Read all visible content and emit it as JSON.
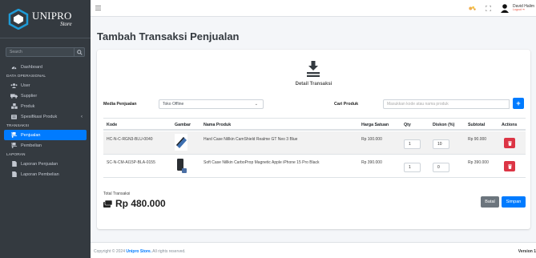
{
  "brand": {
    "name": "UNIPRO",
    "sub": "Store",
    "logo_color": "#1f9bd7"
  },
  "sidebar": {
    "search_placeholder": "Search",
    "items": [
      {
        "type": "item",
        "label": "Dashboard",
        "icon": "dashboard-icon"
      },
      {
        "type": "header",
        "label": "DATA OPERASIONAL"
      },
      {
        "type": "item",
        "label": "User",
        "icon": "users-icon"
      },
      {
        "type": "item",
        "label": "Supplier",
        "icon": "truck-icon"
      },
      {
        "type": "item",
        "label": "Produk",
        "icon": "boxes-icon"
      },
      {
        "type": "item",
        "label": "Spesifikasi Produk",
        "icon": "list-icon",
        "caret": "‹"
      },
      {
        "type": "header",
        "label": "TRANSAKSI"
      },
      {
        "type": "item",
        "label": "Penjualan",
        "icon": "dolly-icon",
        "active": true
      },
      {
        "type": "item",
        "label": "Pembelian",
        "icon": "dolly-icon"
      },
      {
        "type": "header",
        "label": "LAPORAN"
      },
      {
        "type": "item",
        "label": "Laporan Penjualan",
        "icon": "file-icon"
      },
      {
        "type": "item",
        "label": "Laporan Pembelian",
        "icon": "file-icon"
      }
    ]
  },
  "topbar": {
    "user_name": "David Halim",
    "user_role": "Logout ⇥"
  },
  "page": {
    "title": "Tambah Transaksi Penjualan"
  },
  "form": {
    "hero_title": "Detail Transaksi",
    "media_label": "Media Penjualan",
    "media_value": "Toko Offline",
    "search_label": "Cari Produk",
    "search_placeholder": "Masukkan kode atau nama produk",
    "add_symbol": "+"
  },
  "table": {
    "headers": [
      "Kode",
      "Gambar",
      "Nama Produk",
      "Harga Satuan",
      "Qty",
      "Diskon (%)",
      "Subtotal",
      "Actions"
    ],
    "rows": [
      {
        "kode": "HC-N-C-RGN3-BLU-0040",
        "nama": "Hard Case Nillkin CamShield Realme GT Neo 3 Blue",
        "harga": "Rp 100.000",
        "qty": "1",
        "diskon": "10",
        "subtotal": "Rp 90.000"
      },
      {
        "kode": "SC-N-CM-AI15P-BLA-0155",
        "nama": "Soft Case Nillkin CarboProp Magnetic Apple iPhone 15 Pro Black",
        "harga": "Rp 390.000",
        "qty": "1",
        "diskon": "0",
        "subtotal": "Rp 390.000"
      }
    ]
  },
  "summary": {
    "total_label": "Total Transaksi",
    "total_value": "Rp 480.000"
  },
  "buttons": {
    "batal": "Batal",
    "simpan": "Simpan"
  },
  "footer": {
    "copy_prefix": "Copyright © 2024 ",
    "copy_brand": "Unipro Store.",
    "copy_suffix": " All rights reserved.",
    "version": "Version 1"
  }
}
